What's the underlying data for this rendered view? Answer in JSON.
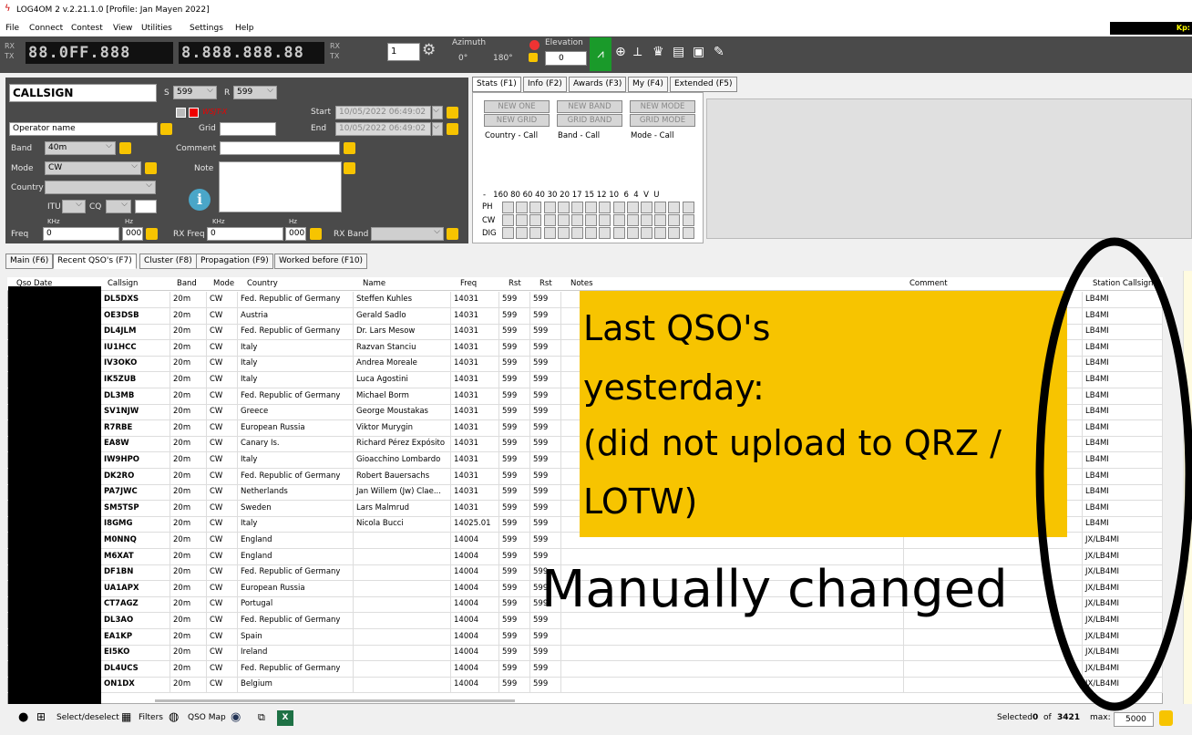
{
  "title": "LOG4OM 2 v.2.21.1.0 [Profile: Jan Mayen 2022]",
  "menu": [
    "File",
    "Connect",
    "Contest",
    "View",
    "Utilities",
    "Settings",
    "Help"
  ],
  "kp_label": "Kp:",
  "toolbar": {
    "rx_label": "RX",
    "tx_label": "TX",
    "freq_display_1": "88.0FF.888",
    "freq_display_2": "8.888.888.88",
    "spin_value": "1",
    "azimuth_label": "Azimuth",
    "azimuth_min": "0°",
    "azimuth_max": "180°",
    "elevation_label": "Elevation",
    "elevation_value": "0"
  },
  "form": {
    "callsign": "CALLSIGN",
    "s_label": "S",
    "s_value": "599",
    "r_label": "R",
    "r_value": "599",
    "operator_placeholder": "Operator name",
    "wsa_label": "WSJT-X",
    "grid_label": "Grid",
    "start_label": "Start",
    "start_value": "10/05/2022 06:49:02",
    "end_label": "End",
    "end_value": "10/05/2022 06:49:02",
    "band_label": "Band",
    "band_value": "40m",
    "comment_label": "Comment",
    "mode_label": "Mode",
    "mode_value": "CW",
    "note_label": "Note",
    "country_label": "Country",
    "itu_label": "ITU",
    "cq_label": "CQ",
    "khz_label": "KHz",
    "hz_label": "Hz",
    "freq_label": "Freq",
    "freq_khz": "0",
    "freq_hz": "000",
    "rxfreq_label": "RX Freq",
    "rxfreq_khz": "0",
    "rxfreq_hz": "000",
    "rxband_label": "RX Band"
  },
  "stats": {
    "tabs": [
      "Stats (F1)",
      "Info (F2)",
      "Awards (F3)",
      "My (F4)",
      "Extended (F5)"
    ],
    "buttons": [
      "NEW ONE",
      "NEW BAND",
      "NEW MODE",
      "NEW GRID",
      "GRID BAND",
      "GRID MODE"
    ],
    "labels": [
      "Country - Call",
      "Band - Call",
      "Mode - Call"
    ],
    "band_header": "-   160 80 60 40 30 20 17 15 12 10  6  4  V  U",
    "mode_rows": [
      "PH",
      "CW",
      "DIG"
    ]
  },
  "main_tabs": [
    "Main (F6)",
    "Recent QSO's (F7)",
    "Cluster (F8)",
    "Propagation (F9)",
    "Worked before (F10)"
  ],
  "table": {
    "headers": [
      "Qso Date",
      "Callsign",
      "Band",
      "Mode",
      "Country",
      "Name",
      "Freq",
      "Rst",
      "Rst",
      "Notes",
      "Comment",
      "Station Callsign"
    ],
    "rows": [
      [
        "DL5DXS",
        "20m",
        "CW",
        "Fed. Republic of Germany",
        "Steffen Kuhles",
        "14031",
        "599",
        "599",
        "LB4MI"
      ],
      [
        "OE3DSB",
        "20m",
        "CW",
        "Austria",
        "Gerald Sadlo",
        "14031",
        "599",
        "599",
        "LB4MI"
      ],
      [
        "DL4JLM",
        "20m",
        "CW",
        "Fed. Republic of Germany",
        "Dr. Lars Mesow",
        "14031",
        "599",
        "599",
        "LB4MI"
      ],
      [
        "IU1HCC",
        "20m",
        "CW",
        "Italy",
        "Razvan Stanciu",
        "14031",
        "599",
        "599",
        "LB4MI"
      ],
      [
        "IV3OKO",
        "20m",
        "CW",
        "Italy",
        "Andrea Moreale",
        "14031",
        "599",
        "599",
        "LB4MI"
      ],
      [
        "IK5ZUB",
        "20m",
        "CW",
        "Italy",
        "Luca Agostini",
        "14031",
        "599",
        "599",
        "LB4MI"
      ],
      [
        "DL3MB",
        "20m",
        "CW",
        "Fed. Republic of Germany",
        "Michael Borm",
        "14031",
        "599",
        "599",
        "LB4MI"
      ],
      [
        "SV1NJW",
        "20m",
        "CW",
        "Greece",
        "George Moustakas",
        "14031",
        "599",
        "599",
        "LB4MI"
      ],
      [
        "R7RBE",
        "20m",
        "CW",
        "European Russia",
        "Viktor Murygin",
        "14031",
        "599",
        "599",
        "LB4MI"
      ],
      [
        "EA8W",
        "20m",
        "CW",
        "Canary Is.",
        "Richard Pérez Expósito",
        "14031",
        "599",
        "599",
        "LB4MI"
      ],
      [
        "IW9HPO",
        "20m",
        "CW",
        "Italy",
        "Gioacchino Lombardo",
        "14031",
        "599",
        "599",
        "LB4MI"
      ],
      [
        "DK2RO",
        "20m",
        "CW",
        "Fed. Republic of Germany",
        "Robert Bauersachs",
        "14031",
        "599",
        "599",
        "LB4MI"
      ],
      [
        "PA7JWC",
        "20m",
        "CW",
        "Netherlands",
        "Jan Willem (Jw) Clae...",
        "14031",
        "599",
        "599",
        "LB4MI"
      ],
      [
        "SM5TSP",
        "20m",
        "CW",
        "Sweden",
        "Lars Malmrud",
        "14031",
        "599",
        "599",
        "LB4MI"
      ],
      [
        "I8GMG",
        "20m",
        "CW",
        "Italy",
        "Nicola Bucci",
        "14025.01",
        "599",
        "599",
        "LB4MI"
      ],
      [
        "M0NNQ",
        "20m",
        "CW",
        "England",
        "",
        "14004",
        "599",
        "599",
        "JX/LB4MI"
      ],
      [
        "M6XAT",
        "20m",
        "CW",
        "England",
        "",
        "14004",
        "599",
        "599",
        "JX/LB4MI"
      ],
      [
        "DF1BN",
        "20m",
        "CW",
        "Fed. Republic of Germany",
        "",
        "14004",
        "599",
        "599",
        "JX/LB4MI"
      ],
      [
        "UA1APX",
        "20m",
        "CW",
        "European Russia",
        "",
        "14004",
        "599",
        "599",
        "JX/LB4MI"
      ],
      [
        "CT7AGZ",
        "20m",
        "CW",
        "Portugal",
        "",
        "14004",
        "599",
        "599",
        "JX/LB4MI"
      ],
      [
        "DL3AO",
        "20m",
        "CW",
        "Fed. Republic of Germany",
        "",
        "14004",
        "599",
        "599",
        "JX/LB4MI"
      ],
      [
        "EA1KP",
        "20m",
        "CW",
        "Spain",
        "",
        "14004",
        "599",
        "599",
        "JX/LB4MI"
      ],
      [
        "EI5KO",
        "20m",
        "CW",
        "Ireland",
        "",
        "14004",
        "599",
        "599",
        "JX/LB4MI"
      ],
      [
        "DL4UCS",
        "20m",
        "CW",
        "Fed. Republic of Germany",
        "",
        "14004",
        "599",
        "599",
        "JX/LB4MI"
      ],
      [
        "ON1DX",
        "20m",
        "CW",
        "Belgium",
        "",
        "14004",
        "599",
        "599",
        "JX/LB4MI"
      ]
    ]
  },
  "statusbar": {
    "select_label": "Select/deselect",
    "filters_label": "Filters",
    "qsomap_label": "QSO Map",
    "selected_label": "Selected",
    "selected_count": "0",
    "of_label": "of",
    "total": "3421",
    "max_label": "max:",
    "max_value": "5000"
  },
  "annotations": {
    "box_lines": [
      "Last QSO's",
      "yesterday:",
      "(did not upload to QRZ /",
      "LOTW)"
    ],
    "manual_text": "Manually changed"
  },
  "colors": {
    "accent_yellow": "#f7c400",
    "toolbar_bg": "#4a4a4a",
    "green": "#1a9a2a"
  }
}
